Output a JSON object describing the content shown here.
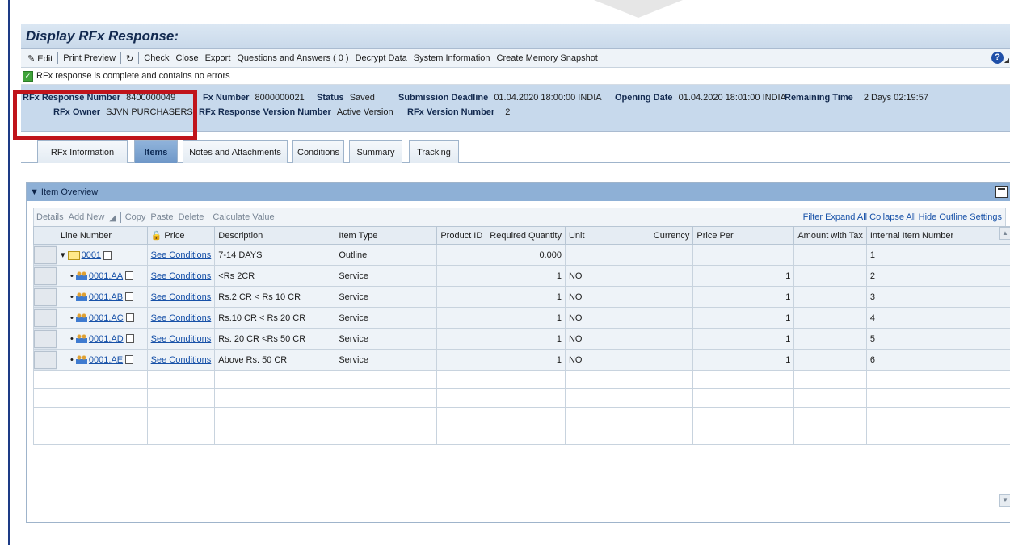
{
  "title": "Display RFx Response:",
  "toolbar": {
    "edit": "Edit",
    "print_preview": "Print Preview",
    "check": "Check",
    "close": "Close",
    "export": "Export",
    "qa": "Questions and Answers ( 0 )",
    "decrypt": "Decrypt Data",
    "sysinfo": "System Information",
    "memsnap": "Create Memory Snapshot",
    "help": "?"
  },
  "message": "RFx response  is complete and contains no errors",
  "header": {
    "resp_num_label": "RFx Response Number",
    "resp_num": "8400000049",
    "rfx_num_label": "Fx Number",
    "rfx_num": "8000000021",
    "status_label": "Status",
    "status": "Saved",
    "deadline_label": "Submission Deadline",
    "deadline": "01.04.2020 18:00:00 INDIA",
    "opening_label": "Opening Date",
    "opening": "01.04.2020 18:01:00 INDIA",
    "remaining_label": "Remaining Time",
    "remaining": "2 Days 02:19:57",
    "owner_label": "RFx Owner",
    "owner": "SJVN PURCHASERS",
    "ver_label": "RFx Response Version Number",
    "ver": "Active Version",
    "rfxver_label": "RFx Version Number",
    "rfxver": "2"
  },
  "tabs": [
    "RFx Information",
    "Items",
    "Notes and Attachments",
    "Conditions",
    "Summary",
    "Tracking"
  ],
  "panel": {
    "title": "Item Overview",
    "grid_toolbar": [
      "Details",
      "Add New",
      "Copy",
      "Paste",
      "Delete",
      "Calculate Value"
    ],
    "right_links": "Filter Expand All Collapse All Hide Outline Settings"
  },
  "columns": [
    "Line Number",
    "Price",
    "Description",
    "Item Type",
    "Product ID",
    "Required Quantity",
    "Unit",
    "Currency",
    "Price Per",
    "Amount with Tax",
    "Internal Item Number"
  ],
  "rows": [
    {
      "line": "0001",
      "price": "See Conditions",
      "desc": "7-14 DAYS",
      "type": "Outline",
      "pid": "",
      "qty": "0.000",
      "unit": "",
      "cur": "",
      "per": "",
      "amt": "",
      "internal": "1"
    },
    {
      "line": "0001.AA",
      "price": "See Conditions",
      "desc": "<Rs 2CR",
      "type": "Service",
      "pid": "",
      "qty": "1",
      "unit": "NO",
      "cur": "",
      "per": "1",
      "amt": "",
      "internal": "2"
    },
    {
      "line": "0001.AB",
      "price": "See Conditions",
      "desc": "Rs.2 CR < Rs 10 CR",
      "type": "Service",
      "pid": "",
      "qty": "1",
      "unit": "NO",
      "cur": "",
      "per": "1",
      "amt": "",
      "internal": "3"
    },
    {
      "line": "0001.AC",
      "price": "See Conditions",
      "desc": "Rs.10 CR < Rs 20 CR",
      "type": "Service",
      "pid": "",
      "qty": "1",
      "unit": "NO",
      "cur": "",
      "per": "1",
      "amt": "",
      "internal": "4"
    },
    {
      "line": "0001.AD",
      "price": "See Conditions",
      "desc": "Rs. 20 CR <Rs 50 CR",
      "type": "Service",
      "pid": "",
      "qty": "1",
      "unit": "NO",
      "cur": "",
      "per": "1",
      "amt": "",
      "internal": "5"
    },
    {
      "line": "0001.AE",
      "price": "See Conditions",
      "desc": "Above Rs. 50 CR",
      "type": "Service",
      "pid": "",
      "qty": "1",
      "unit": "NO",
      "cur": "",
      "per": "1",
      "amt": "",
      "internal": "6"
    }
  ]
}
